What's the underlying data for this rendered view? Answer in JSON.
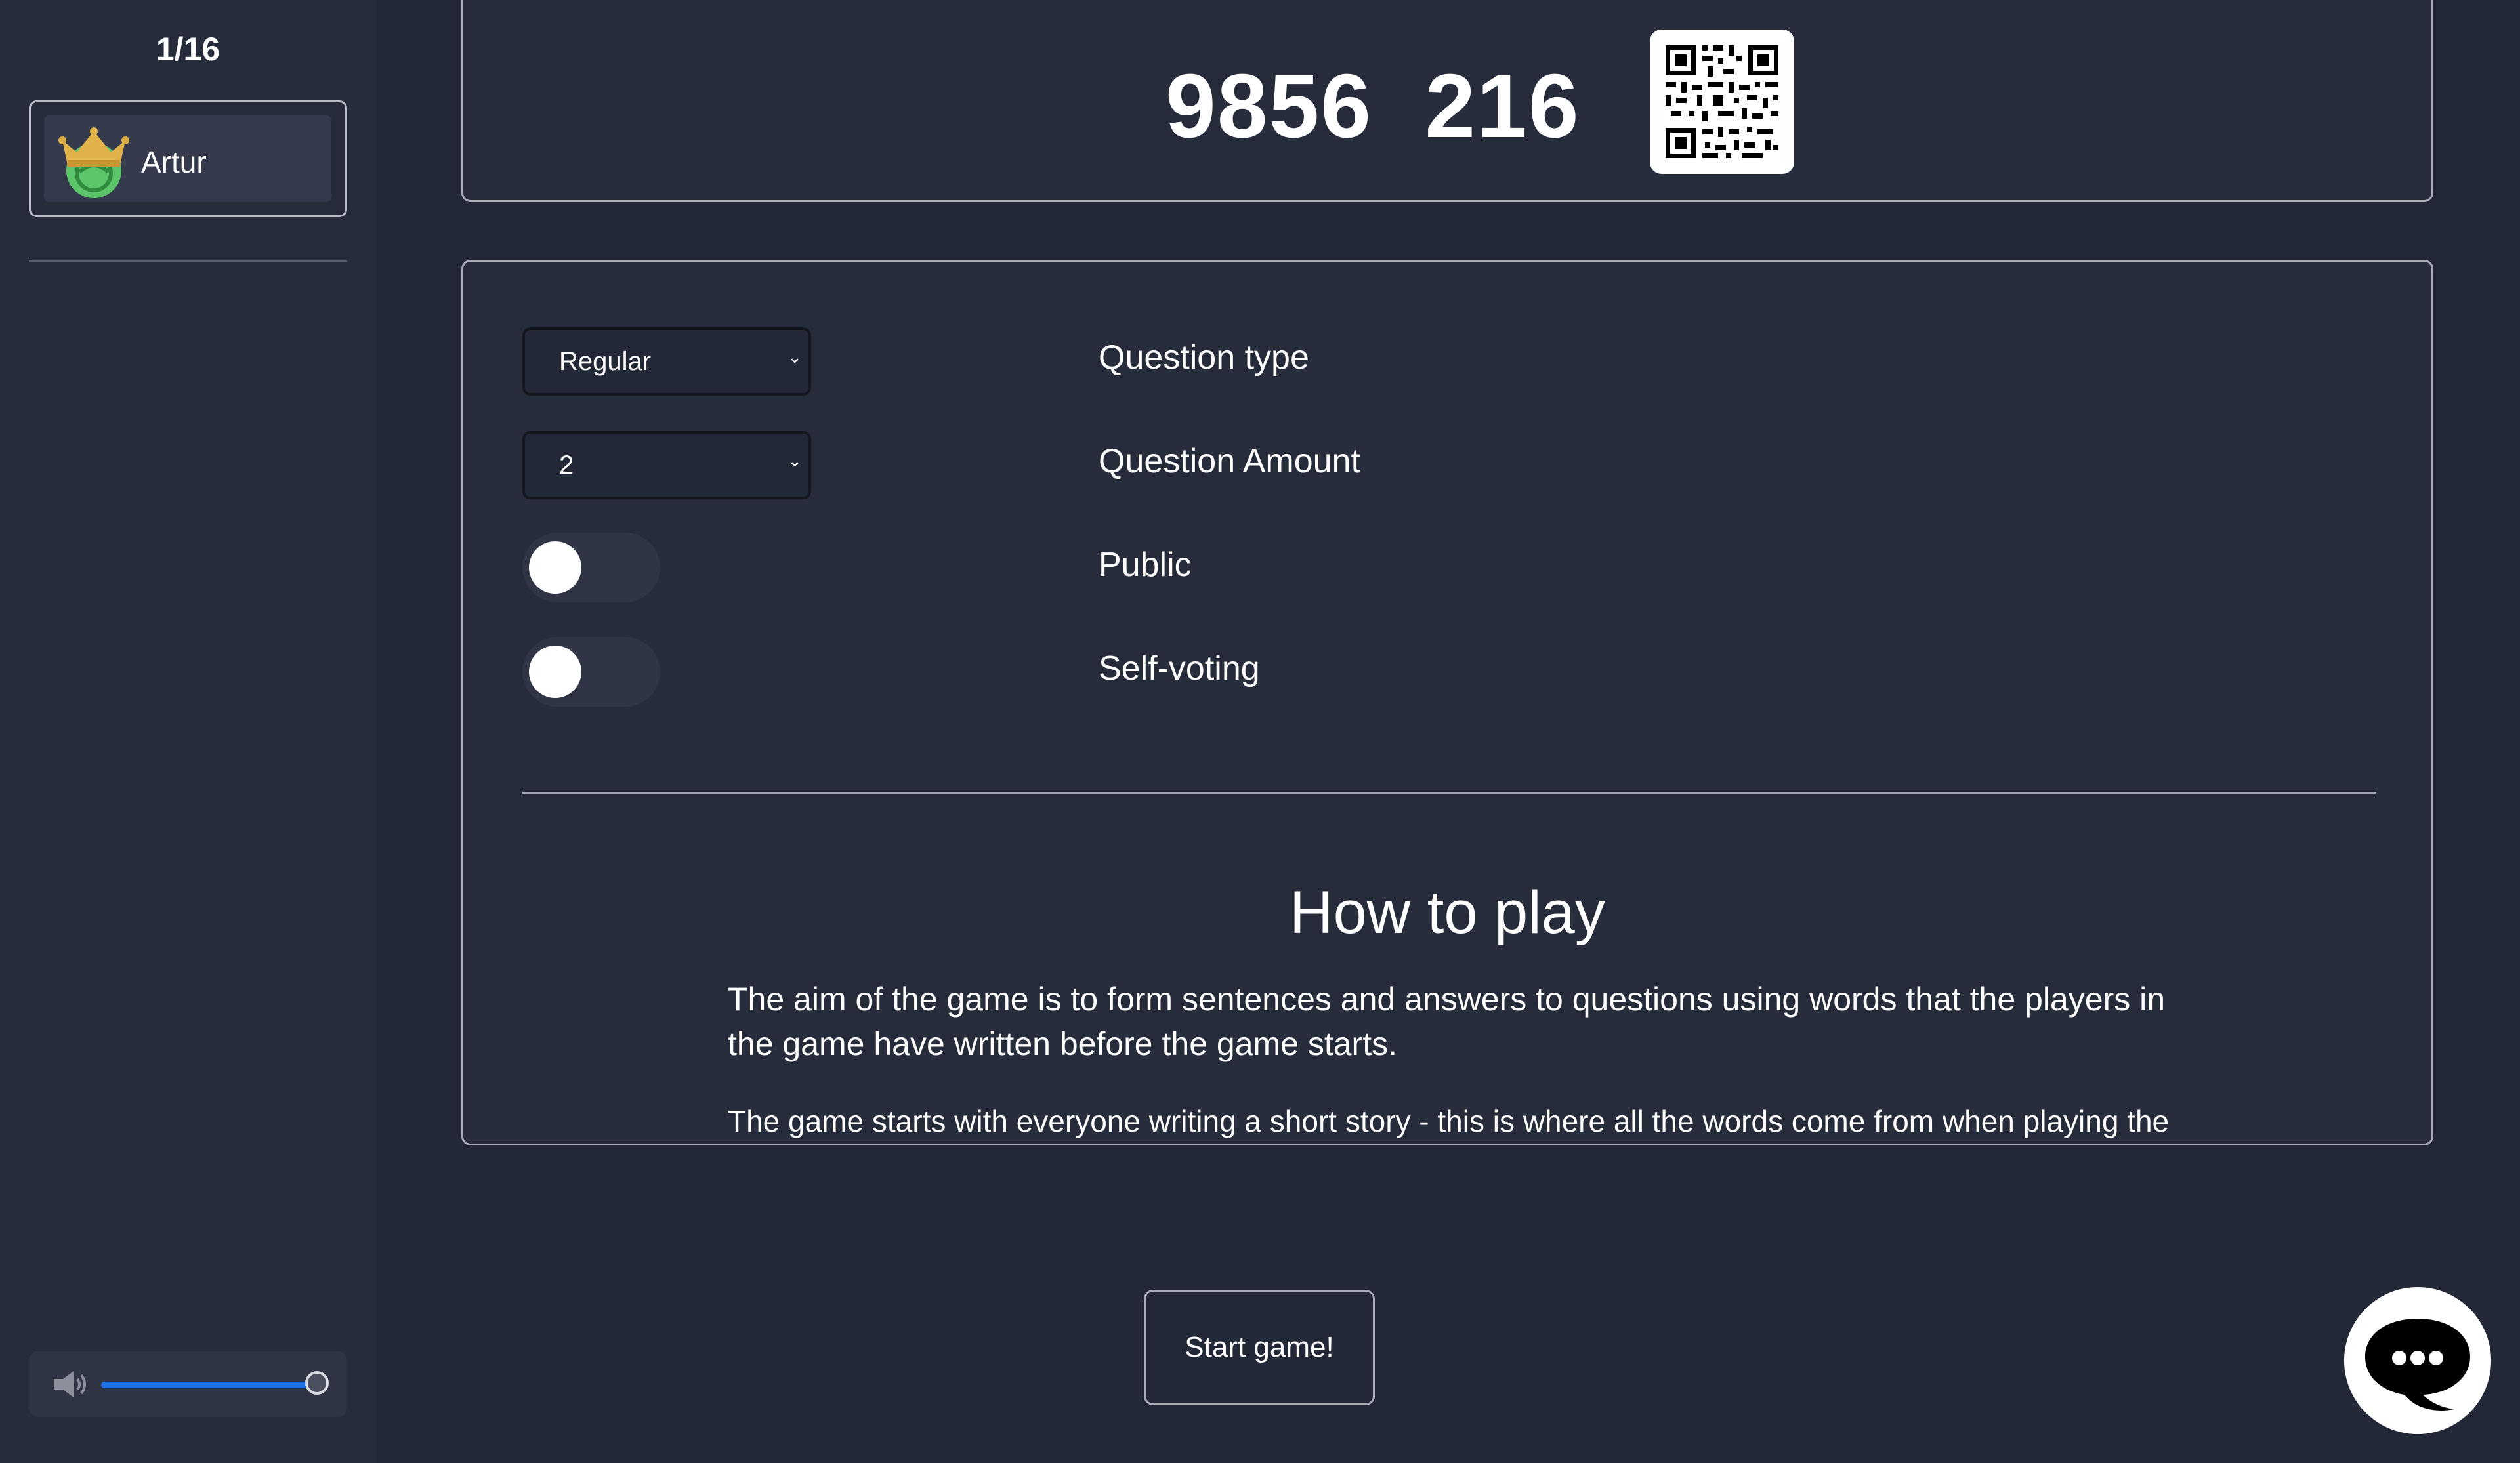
{
  "sidebar": {
    "player_count": "1/16",
    "players": [
      {
        "name": "Artur",
        "is_host": true
      }
    ],
    "volume": {
      "level_percent": 100
    }
  },
  "lobby": {
    "game_code": "9856  216"
  },
  "settings": {
    "question_type": {
      "value": "Regular",
      "label": "Question type"
    },
    "question_amount": {
      "value": "2",
      "label": "Question Amount"
    },
    "public": {
      "on": false,
      "label": "Public"
    },
    "self_voting": {
      "on": false,
      "label": "Self-voting"
    }
  },
  "how_to_play": {
    "title": "How to play",
    "paragraphs": [
      "The aim of the game is to form sentences and answers to questions using words that the players in the game have written before the game starts.",
      "The game starts with everyone writing a short story - this is where all the words come from when playing the"
    ]
  },
  "actions": {
    "start_label": "Start game!"
  },
  "colors": {
    "background": "#232837",
    "panel": "#272c3b",
    "accent": "#1f6fe0",
    "avatar_green": "#5cc46a",
    "crown_gold": "#e2b24a"
  }
}
